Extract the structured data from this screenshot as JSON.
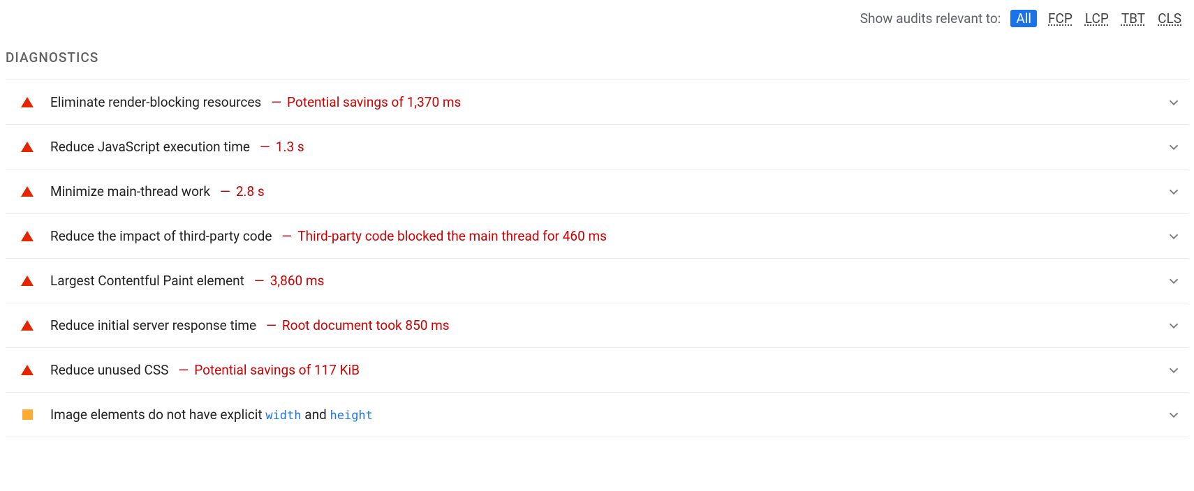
{
  "filter": {
    "label": "Show audits relevant to:",
    "chips": [
      "All",
      "FCP",
      "LCP",
      "TBT",
      "CLS"
    ],
    "active_index": 0
  },
  "section_title": "DIAGNOSTICS",
  "audits": [
    {
      "severity": "fail",
      "title": "Eliminate render-blocking resources",
      "detail": "Potential savings of 1,370 ms"
    },
    {
      "severity": "fail",
      "title": "Reduce JavaScript execution time",
      "detail": "1.3 s"
    },
    {
      "severity": "fail",
      "title": "Minimize main-thread work",
      "detail": "2.8 s"
    },
    {
      "severity": "fail",
      "title": "Reduce the impact of third-party code",
      "detail": "Third-party code blocked the main thread for 460 ms"
    },
    {
      "severity": "fail",
      "title": "Largest Contentful Paint element",
      "detail": "3,860 ms"
    },
    {
      "severity": "fail",
      "title": "Reduce initial server response time",
      "detail": "Root document took 850 ms"
    },
    {
      "severity": "fail",
      "title": "Reduce unused CSS",
      "detail": "Potential savings of 117 KiB"
    },
    {
      "severity": "warn",
      "title_parts": [
        "Image elements do not have explicit ",
        {
          "code": "width"
        },
        " and ",
        {
          "code": "height"
        }
      ],
      "detail": ""
    }
  ]
}
